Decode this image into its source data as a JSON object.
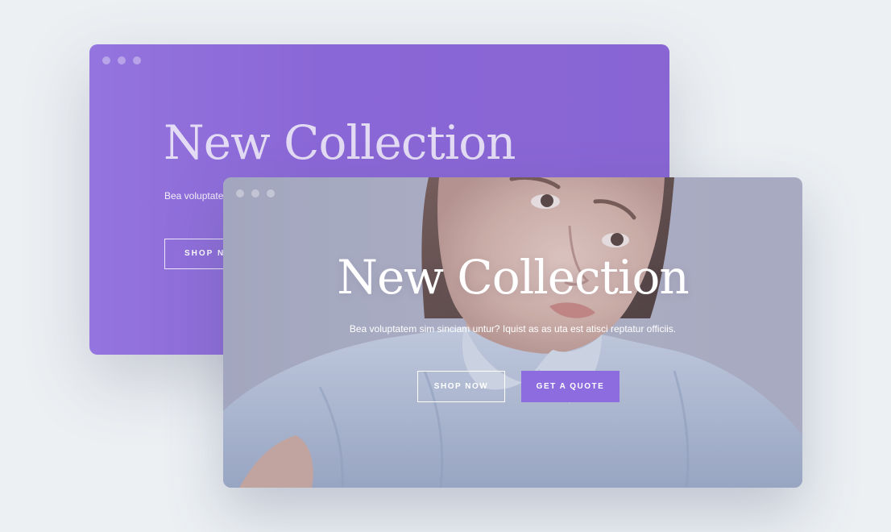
{
  "colors": {
    "page_background": "#ecf0f3",
    "back_window_purple": "#8a67d6",
    "accent_button": "#8d6ce0",
    "front_window_tint": "#aaaec4"
  },
  "back_window": {
    "heading": "New Collection",
    "subtitle": "Bea voluptate",
    "shop_button_label": "SHOP NO"
  },
  "front_window": {
    "heading": "New Collection",
    "subtitle": "Bea voluptatem sim sinciam untur? Iquist as as uta est atisci reptatur officiis.",
    "shop_button_label": "SHOP NOW",
    "quote_button_label": "GET A QUOTE"
  }
}
